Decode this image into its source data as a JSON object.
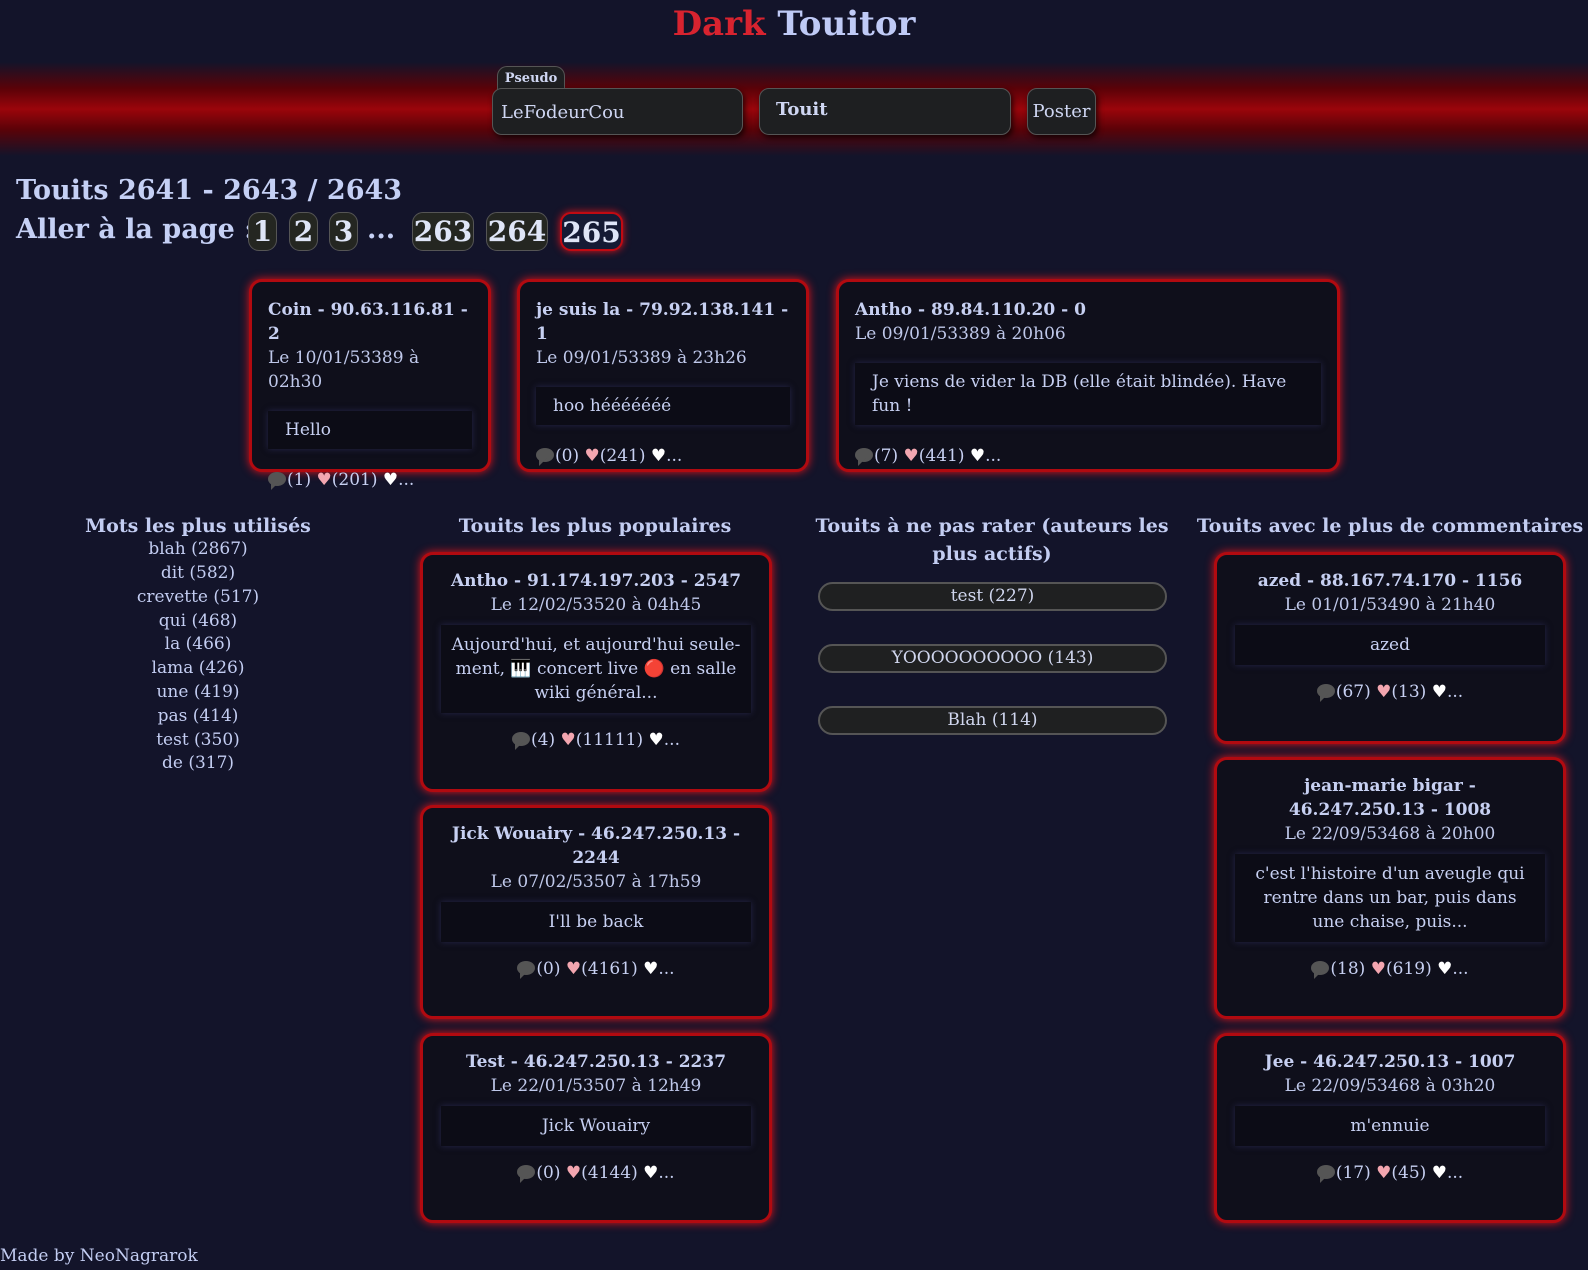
{
  "header": {
    "title_part1": "Dark",
    "title_part2": "Touitor",
    "pseudo_label": "Pseudo",
    "pseudo_value": "LeFodeurCou",
    "touit_placeholder": "Touit",
    "post_label": "Poster"
  },
  "listing": {
    "count_text": "Touits 2641 - 2643 / 2643",
    "goto_label": "Aller à la page :",
    "pages": [
      "1",
      "2",
      "3",
      "263",
      "264",
      "265"
    ],
    "ellipsis": "...",
    "active_page": "265"
  },
  "touits": [
    {
      "head": "Coin - 90.63.116.81 - 2",
      "date": "Le 10/01/53389 à 02h30",
      "message": "Hello",
      "comments": "(1)",
      "likes": "(201)",
      "more": "..."
    },
    {
      "head": "je suis la - 79.92.138.141 - 1",
      "date": "Le 09/01/53389 à 23h26",
      "message": "hoo hééééééé",
      "comments": "(0)",
      "likes": "(241)",
      "more": "..."
    },
    {
      "head": "Antho - 89.84.110.20 - 0",
      "date": "Le 09/01/53389 à 20h06",
      "message": "Je viens de vider la DB (elle était blindée). Have fun !",
      "comments": "(7)",
      "likes": "(441)",
      "more": "..."
    }
  ],
  "words": {
    "title": "Mots les plus utilisés",
    "items": [
      "blah (2867)",
      "dit (582)",
      "crevette (517)",
      "qui (468)",
      "la (466)",
      "lama (426)",
      "une (419)",
      "pas (414)",
      "test (350)",
      "de (317)"
    ]
  },
  "popular": {
    "title": "Touits les plus populaires",
    "items": [
      {
        "head": "Antho - 91.174.197.203 - 2547",
        "date": "Le 12/02/53520 à 04h45",
        "message": "Aujourd'hui, et aujourd'hui seule-ment, 🎹 concert live 🔴 en salle wiki général...",
        "comments": "(4)",
        "likes": "(11111)",
        "more": "..."
      },
      {
        "head": "Jick Wouairy - 46.247.250.13 - 2244",
        "date": "Le 07/02/53507 à 17h59",
        "message": "I'll be back",
        "comments": "(0)",
        "likes": "(4161)",
        "more": "..."
      },
      {
        "head": "Test - 46.247.250.13 - 2237",
        "date": "Le 22/01/53507 à 12h49",
        "message": "Jick Wouairy",
        "comments": "(0)",
        "likes": "(4144)",
        "more": "..."
      }
    ]
  },
  "authors": {
    "title": "Touits à ne pas rater (auteurs les plus actifs)",
    "items": [
      "test (227)",
      "YOOOOOOOOOO (143)",
      "Blah (114)"
    ]
  },
  "commented": {
    "title": "Touits avec le plus de commentaires",
    "items": [
      {
        "head": "azed - 88.167.74.170 - 1156",
        "date": "Le 01/01/53490 à 21h40",
        "message": "azed",
        "comments": "(67)",
        "likes": "(13)",
        "more": "..."
      },
      {
        "head": "jean-marie bigar - 46.247.250.13 - 1008",
        "date": "Le 22/09/53468 à 20h00",
        "message": "c'est l'histoire d'un aveugle qui rentre dans un bar, puis dans une chaise, puis...",
        "comments": "(18)",
        "likes": "(619)",
        "more": "..."
      },
      {
        "head": "Jee - 46.247.250.13 - 1007",
        "date": "Le 22/09/53468 à 03h20",
        "message": "m'ennuie",
        "comments": "(17)",
        "likes": "(45)",
        "more": "..."
      }
    ]
  },
  "footer": {
    "credit": "Made by NeoNagrarok"
  },
  "icons": {
    "comment": "speech-bubble-icon",
    "like": "heart-icon",
    "like_action": "white-heart-icon"
  },
  "colors": {
    "accent_red": "#d8232f",
    "title_blue": "#bfcaf6",
    "card_border": "#b10a10",
    "background": "#13142a"
  }
}
